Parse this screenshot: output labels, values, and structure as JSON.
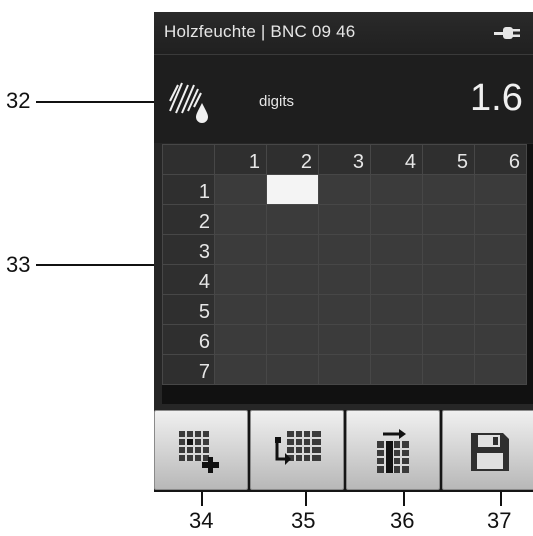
{
  "titlebar": {
    "title": "Holzfeuchte | BNC  09 46",
    "power_icon": "plug-icon"
  },
  "infobar": {
    "mode_label": "digits",
    "reading": "1.6",
    "sensor_icon": "fingerprint-drop-icon"
  },
  "grid": {
    "column_headers": [
      "1",
      "2",
      "3",
      "4",
      "5",
      "6"
    ],
    "row_headers": [
      "1",
      "2",
      "3",
      "4",
      "5",
      "6",
      "7"
    ],
    "selected_cell": {
      "row": "1",
      "column": "2"
    }
  },
  "toolbar": {
    "buttons": [
      {
        "icon": "grid-add-icon"
      },
      {
        "icon": "grid-move-icon"
      },
      {
        "icon": "column-shift-icon"
      },
      {
        "icon": "save-icon"
      }
    ]
  },
  "callouts": [
    "32",
    "33",
    "34",
    "35",
    "36",
    "37"
  ]
}
